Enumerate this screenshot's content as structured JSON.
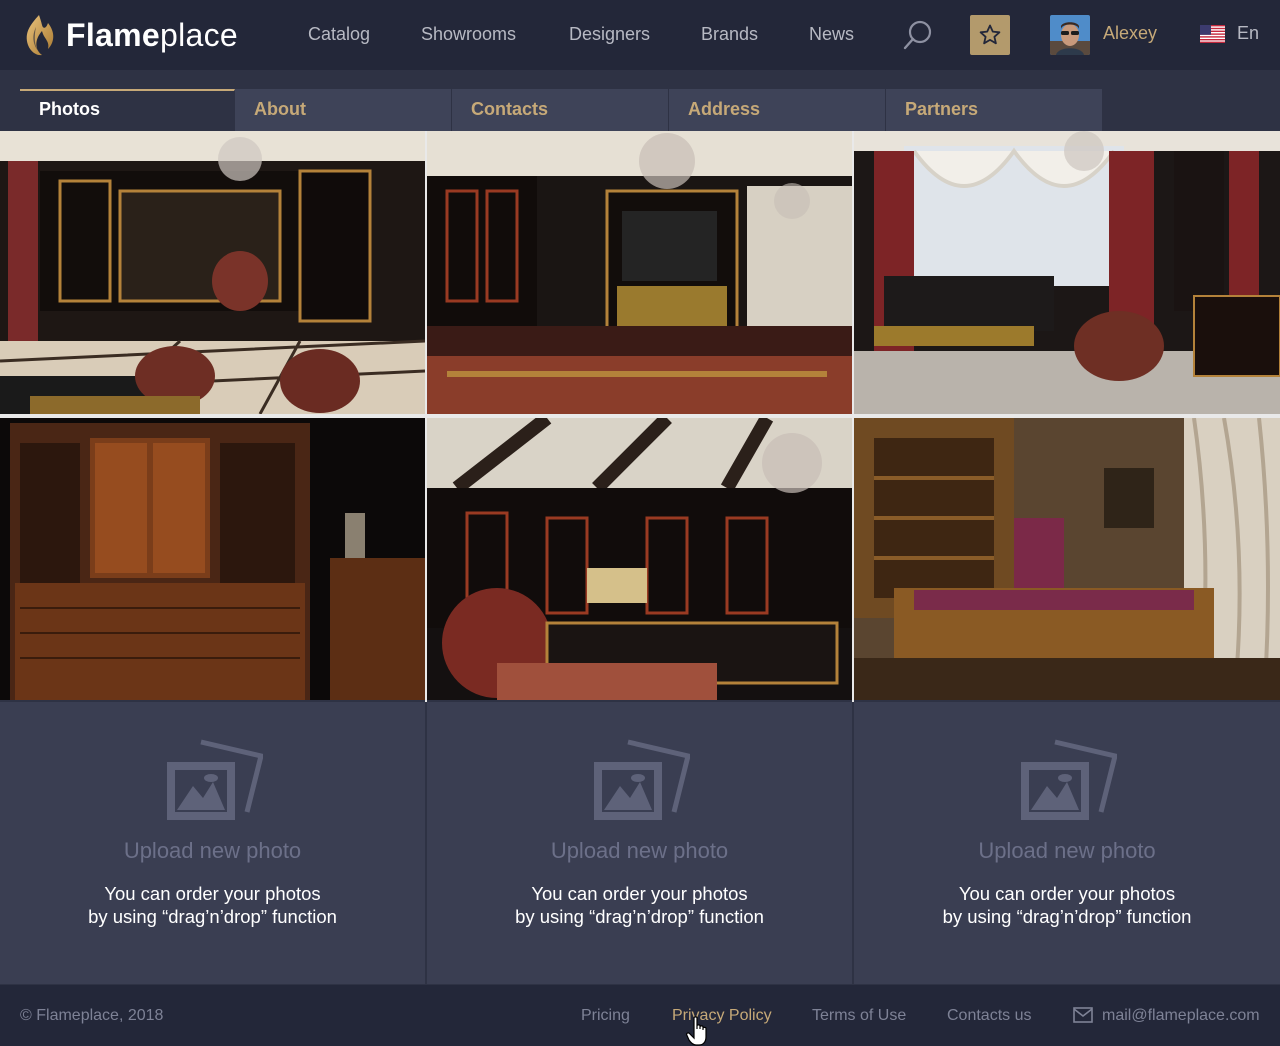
{
  "brand": {
    "name_bold": "Flame",
    "name_light": "place"
  },
  "nav": {
    "items": [
      {
        "label": "Catalog"
      },
      {
        "label": "Showrooms"
      },
      {
        "label": "Designers"
      },
      {
        "label": "Brands"
      },
      {
        "label": "News"
      }
    ],
    "search_icon": "search-icon",
    "favorites_icon": "star-icon"
  },
  "user": {
    "name": "Alexey"
  },
  "language": {
    "flag": "us-flag",
    "label": "En"
  },
  "tabs": [
    {
      "label": "Photos",
      "active": true
    },
    {
      "label": "About"
    },
    {
      "label": "Contacts"
    },
    {
      "label": "Address"
    },
    {
      "label": "Partners"
    }
  ],
  "upload": {
    "title": "Upload new photo",
    "hint_line1": "You can order your photos",
    "hint_line2": "by using “drag’n’drop” function"
  },
  "footer": {
    "copyright": "© Flameplace, 2018",
    "links": [
      {
        "label": "Pricing"
      },
      {
        "label": "Privacy Policy"
      },
      {
        "label": "Terms of Use"
      },
      {
        "label": "Contacts us"
      }
    ],
    "email": "mail@flameplace.com"
  },
  "colors": {
    "header_bg": "#232739",
    "page_bg": "#2e3244",
    "accent_gold": "#c6a978",
    "upload_bg": "#3a3e52"
  }
}
